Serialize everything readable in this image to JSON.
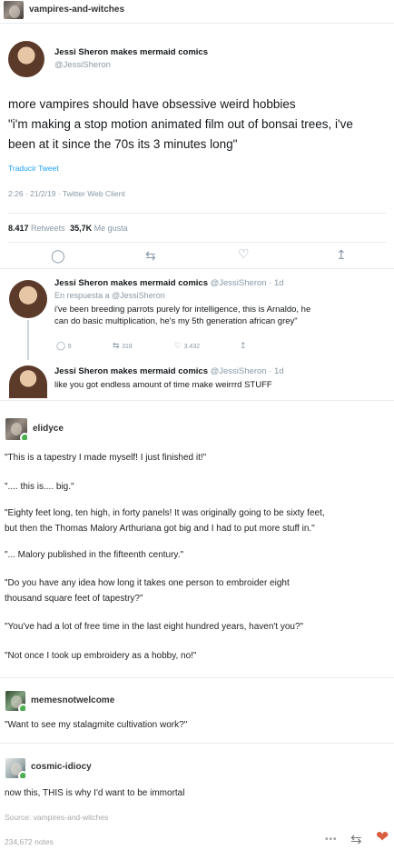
{
  "header": {
    "blog": "vampires-and-witches"
  },
  "tweet": {
    "author_name": "Jessi Sheron makes mermaid comics",
    "author_handle": "@JessiSheron",
    "text_line1": "more vampires should have obsessive weird hobbies",
    "text_line2": "\"i'm making a stop motion animated film out of bonsai trees, i've",
    "text_line3": "been at it since the 70s its 3 minutes long\"",
    "translate": "Traducir Tweet",
    "meta": "2:26 · 21/2/19 · Twitter Web Client",
    "retweets_count": "8.417",
    "retweets_label": "Retweets",
    "likes_count": "35,7K",
    "likes_label": "Me gusta"
  },
  "reply1": {
    "name": "Jessi Sheron makes mermaid comics",
    "meta": "@JessiSheron · 1d",
    "in_reply": "En respuesta a @JessiSheron",
    "line1": "i've been breeding parrots purely for intelligence, this is Arnaldo, he",
    "line2": "can do basic multiplication, he's my 5th generation african grey\"",
    "replies": "9",
    "retweets": "318",
    "likes": "3.432"
  },
  "reply2": {
    "name": "Jessi Sheron makes mermaid comics",
    "meta": "@JessiSheron · 1d",
    "text": "like you got endless amount of time make weirrrd STUFF"
  },
  "post1": {
    "blog": "elidyce",
    "p1": "\"This is a tapestry I made myself! I just finished it!\"",
    "p2": "\".... this is.... big.\"",
    "p3a": "\"Eighty feet long, ten high, in forty panels! It was originally going to be sixty feet,",
    "p3b": "but then the Thomas Malory Arthuriana got big and I had to put more stuff in.\"",
    "p4": "\"... Malory published in the fifteenth century.\"",
    "p5a": "\"Do you have any idea how long it takes one person to embroider eight",
    "p5b": "thousand square feet of tapestry?\"",
    "p6": "\"You've had a lot of free time in the last eight hundred years, haven't you?\"",
    "p7": "\"Not once I took up embroidery as a hobby, no!\""
  },
  "post2": {
    "blog": "memesnotwelcome",
    "text": "\"Want to see my stalagmite cultivation work?\""
  },
  "post3": {
    "blog": "cosmic-idiocy",
    "text": "now this, THIS is why I'd want to be immortal"
  },
  "footer": {
    "source": "Source: vampires-and-witches",
    "notes": "234,672 notes",
    "more": "•••"
  },
  "colors": {
    "twitter_blue": "#1da1f2",
    "muted": "#8899a6",
    "heart": "#d95e40"
  }
}
